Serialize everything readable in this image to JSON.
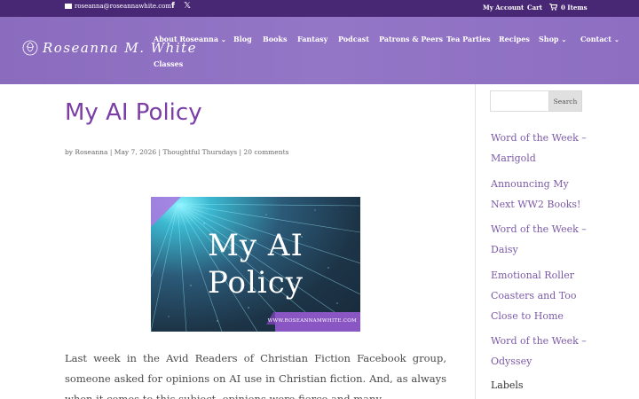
{
  "topbar": {
    "email": "roseanna@roseannawhite.com",
    "facebook_icon": "f",
    "x_icon": "𝕏",
    "my_account": "My Account",
    "cart": "Cart",
    "items": "0 Items"
  },
  "header": {
    "logo_text": "Roseanna M. White",
    "nav": [
      {
        "label": "About Roseanna",
        "dropdown": true
      },
      {
        "label": "Classes",
        "dropdown": false
      },
      {
        "label": "Blog",
        "dropdown": false
      },
      {
        "label": "Books",
        "dropdown": false
      },
      {
        "label": "Fantasy",
        "dropdown": false
      },
      {
        "label": "Podcast",
        "dropdown": false
      },
      {
        "label": "Patrons & Peers",
        "dropdown": false
      },
      {
        "label": "Tea Parties",
        "dropdown": false
      },
      {
        "label": "Recipes",
        "dropdown": false
      },
      {
        "label": "Shop",
        "dropdown": true
      },
      {
        "label": "Contact",
        "dropdown": true
      }
    ],
    "chevron": "⌄"
  },
  "post": {
    "title": "My AI Policy",
    "meta": "by Roseanna | May 7, 2026 | Thoughtful Thursdays | 20 comments",
    "image": {
      "line1": "My AI",
      "line2": "Policy",
      "site": "WWW.ROSEANNAMWHITE.COM"
    },
    "body": "Last week in the Avid Readers of Christian Fiction Facebook group, someone asked for opinions on AI use in Christian fiction. And, as always when it comes to this subject, opinions were fierce and many."
  },
  "sidebar": {
    "search_placeholder": "",
    "search_button": "Search",
    "recent_posts": [
      "Word of the Week – Marigold",
      "Announcing My Next WW2 Books!",
      "Word of the Week – Daisy",
      "Emotional Roller Coasters and Too Close to Home",
      "Word of the Week – Odyssey"
    ],
    "labels_heading": "Labels"
  },
  "colors": {
    "topbar": "#482775",
    "header": "#9476c7",
    "title": "#7a3ea6",
    "link": "#7b5aa6"
  }
}
